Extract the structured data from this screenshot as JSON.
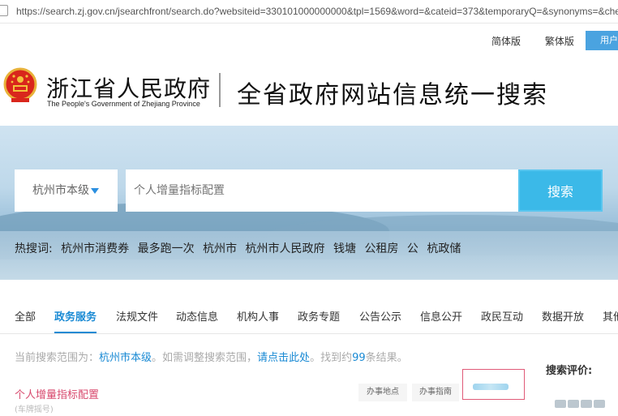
{
  "browser": {
    "url": "https://search.zj.gov.cn/jsearchfront/search.do?websiteid=330101000000000&tpl=1569&word=&cateid=373&temporaryQ=&synonyms=&checkError="
  },
  "header": {
    "lang_simplified": "简体版",
    "lang_traditional": "繁体版",
    "user_button": "用户",
    "logo_cn": "浙江省人民政府",
    "logo_en": "The People's Government of Zhejiang Province",
    "system_title": "全省政府网站信息统一搜索"
  },
  "search": {
    "region": "杭州市本级",
    "placeholder": "个人增量指标配置",
    "button": "搜索"
  },
  "hot": {
    "label": "热搜词:",
    "words": [
      "杭州市消费券",
      "最多跑一次",
      "杭州市",
      "杭州市人民政府",
      "钱塘",
      "公租房",
      "公",
      "杭政储"
    ]
  },
  "tabs": [
    "全部",
    "政务服务",
    "法规文件",
    "动态信息",
    "机构人事",
    "政务专题",
    "公告公示",
    "信息公开",
    "政民互动",
    "数据开放",
    "其他"
  ],
  "active_tab": "政务服务",
  "result_info": {
    "prefix": "当前搜索范围为：",
    "scope": "杭州市本级",
    "middle": "。如需调整搜索范围，",
    "link": "请点击此处",
    "suffix_before": "。找到约",
    "count": "99",
    "suffix_after": "条结果。"
  },
  "evaluation_label": "搜索评价:",
  "results": [
    {
      "title": "个人增量指标配置",
      "category": "(车牌摇号)",
      "tag1": "办事地点",
      "tag2": "办事指南"
    }
  ],
  "colors": {
    "accent": "#1a8ad4",
    "search_button": "#3bb9e8",
    "result_title": "#d84a6e"
  }
}
